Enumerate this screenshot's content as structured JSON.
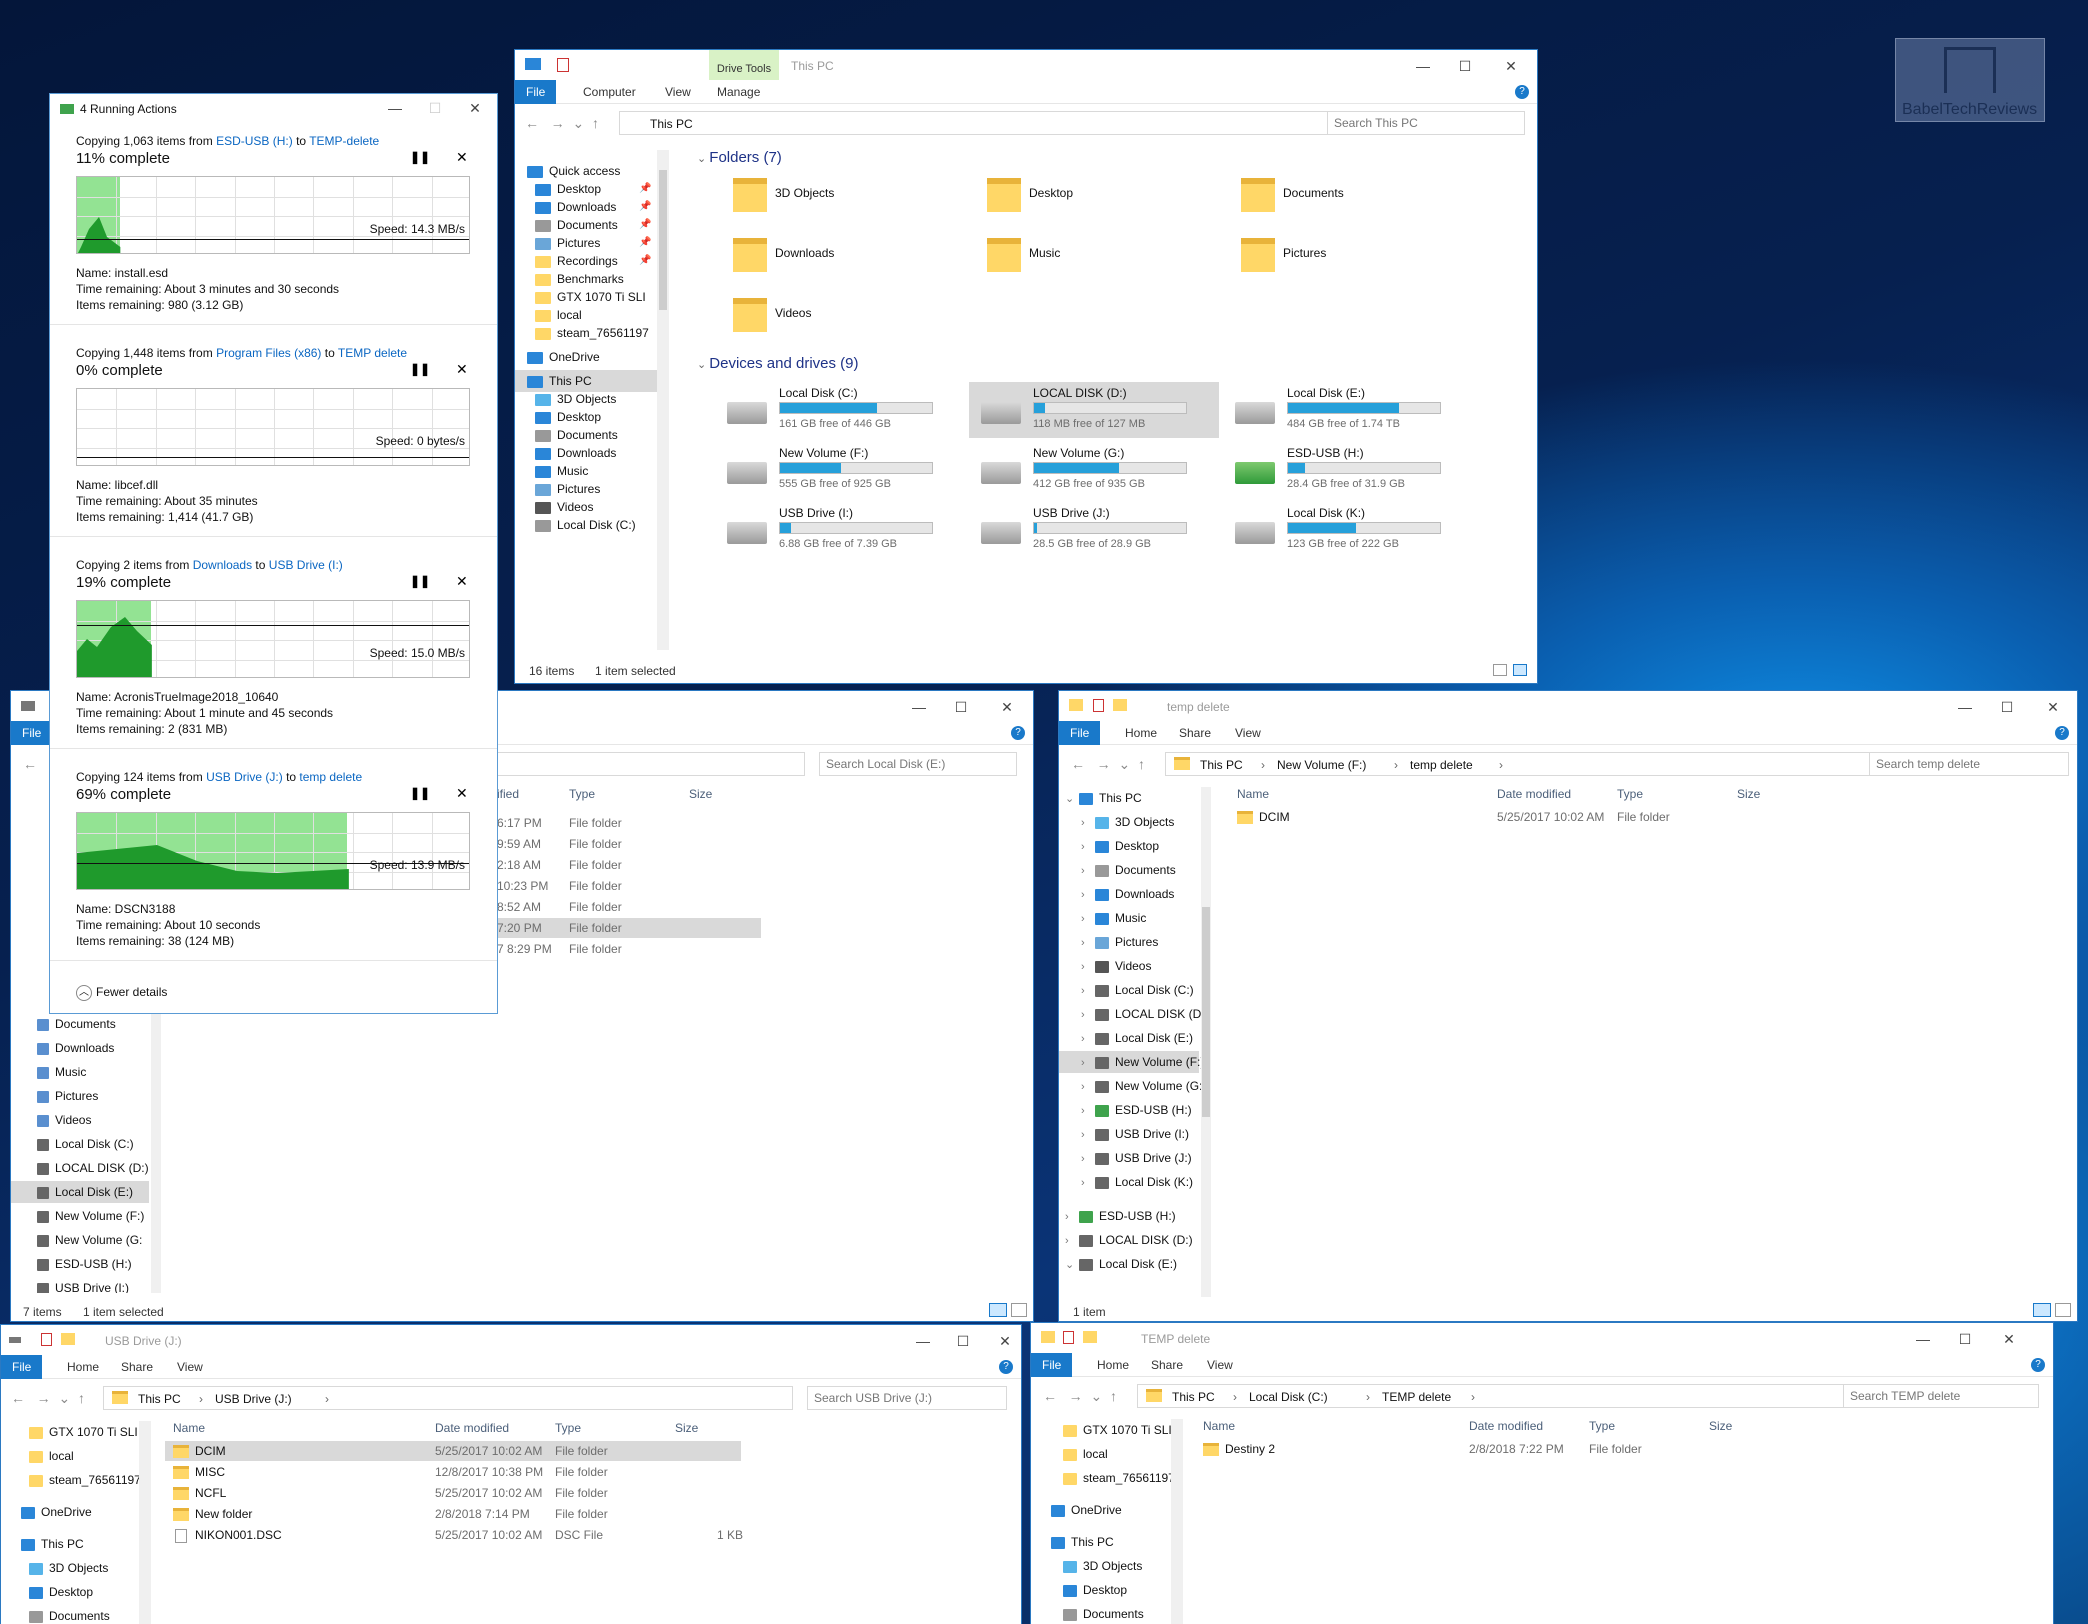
{
  "watermark": {
    "text": "BabelTechReviews"
  },
  "main": {
    "ribbon_extra": "Drive Tools",
    "title": "This PC",
    "tabs": [
      "File",
      "Computer",
      "View",
      "Manage"
    ],
    "address": "This PC",
    "search_placeholder": "Search This PC",
    "nav": [
      "Quick access",
      "Desktop",
      "Downloads",
      "Documents",
      "Pictures",
      "Recordings",
      "Benchmarks",
      "GTX 1070 Ti SLI",
      "local",
      "steam_76561197",
      "OneDrive",
      "This PC",
      "3D Objects",
      "Desktop",
      "Documents",
      "Downloads",
      "Music",
      "Pictures",
      "Videos",
      "Local Disk (C:)"
    ],
    "folders_header": "Folders (7)",
    "folders": [
      "3D Objects",
      "Desktop",
      "Documents",
      "Downloads",
      "Music",
      "Pictures",
      "Videos"
    ],
    "drives_header": "Devices and drives (9)",
    "drives": [
      {
        "name": "Local Disk (C:)",
        "free": "161 GB free of 446 GB",
        "used": 0.64
      },
      {
        "name": "LOCAL DISK (D:)",
        "free": "118 MB free of 127 MB",
        "used": 0.07
      },
      {
        "name": "Local Disk (E:)",
        "free": "484 GB free of 1.74 TB",
        "used": 0.73
      },
      {
        "name": "New Volume (F:)",
        "free": "555 GB free of 925 GB",
        "used": 0.4
      },
      {
        "name": "New Volume (G:)",
        "free": "412 GB free of 935 GB",
        "used": 0.56
      },
      {
        "name": "ESD-USB (H:)",
        "free": "28.4 GB free of 31.9 GB",
        "used": 0.11
      },
      {
        "name": "USB Drive (I:)",
        "free": "6.88 GB free of 7.39 GB",
        "used": 0.07
      },
      {
        "name": "USB Drive (J:)",
        "free": "28.5 GB free of 28.9 GB",
        "used": 0.02
      },
      {
        "name": "Local Disk (K:)",
        "free": "123 GB free of 222 GB",
        "used": 0.45
      }
    ],
    "status_items": "16 items",
    "status_selected": "1 item selected"
  },
  "copy": {
    "title": "4 Running Actions",
    "jobs": [
      {
        "line_a": "Copying 1,063 items from ",
        "src": "ESD-USB (H:)",
        "line_b": " to ",
        "dst": "TEMP-delete",
        "pct": "11% complete",
        "progress": 0.11,
        "speed": "Speed: 14.3 MB/s",
        "name": "Name:  install.esd",
        "time": "Time remaining:  About 3 minutes and 30 seconds",
        "items": "Items remaining:  980 (3.12 GB)"
      },
      {
        "line_a": "Copying 1,448 items from ",
        "src": "Program Files (x86)",
        "line_b": " to ",
        "dst": "TEMP delete",
        "pct": "0% complete",
        "progress": 0.0,
        "speed": "Speed: 0 bytes/s",
        "name": "Name:  libcef.dll",
        "time": "Time remaining:  About 35 minutes",
        "items": "Items remaining:  1,414 (41.7 GB)"
      },
      {
        "line_a": "Copying 2 items from ",
        "src": "Downloads",
        "line_b": " to ",
        "dst": "USB Drive (I:)",
        "pct": "19% complete",
        "progress": 0.19,
        "speed": "Speed: 15.0 MB/s",
        "name": "Name:  AcronisTrueImage2018_10640",
        "time": "Time remaining:  About 1 minute and 45 seconds",
        "items": "Items remaining:  2 (831 MB)"
      },
      {
        "line_a": "Copying 124 items from ",
        "src": "USB Drive (J:)",
        "line_b": " to ",
        "dst": "temp delete",
        "pct": "69% complete",
        "progress": 0.69,
        "speed": "Speed: 13.9 MB/s",
        "name": "Name:  DSCN3188",
        "time": "Time remaining:  About 10 seconds",
        "items": "Items remaining:  38 (124 MB)"
      }
    ],
    "fewer": "Fewer details"
  },
  "winE": {
    "search_placeholder": "Search Local Disk (E:)",
    "cols": [
      "Type",
      "Size"
    ],
    "rows": [
      [
        "6:17 PM",
        "File folder"
      ],
      [
        "9:59 AM",
        "File folder"
      ],
      [
        "2:18 AM",
        "File folder"
      ],
      [
        "10:23 PM",
        "File folder"
      ],
      [
        "8:52 AM",
        "File folder"
      ],
      [
        "7:20 PM",
        "File folder"
      ],
      [
        "7 8:29 PM",
        "File folder"
      ]
    ],
    "col_partial": "ified",
    "nav": [
      "Documents",
      "Downloads",
      "Music",
      "Pictures",
      "Videos",
      "Local Disk (C:)",
      "LOCAL DISK (D:)",
      "Local Disk (E:)",
      "New Volume (F:)",
      "New Volume (G:",
      "ESD-USB (H:)",
      "USB Drive (I:)"
    ],
    "file_tab": "File",
    "status_items": "7 items",
    "status_selected": "1 item selected"
  },
  "winF": {
    "title": "temp delete",
    "tabs": [
      "File",
      "Home",
      "Share",
      "View"
    ],
    "crumbs": [
      "This PC",
      "New Volume (F:)",
      "temp delete"
    ],
    "search_placeholder": "Search temp delete",
    "cols": [
      "Name",
      "Date modified",
      "Type",
      "Size"
    ],
    "rows": [
      [
        "DCIM",
        "5/25/2017 10:02 AM",
        "File folder",
        ""
      ]
    ],
    "nav": [
      "This PC",
      "3D Objects",
      "Desktop",
      "Documents",
      "Downloads",
      "Music",
      "Pictures",
      "Videos",
      "Local Disk (C:)",
      "LOCAL DISK (D:)",
      "Local Disk (E:)",
      "New Volume (F:)",
      "New Volume (G:",
      "ESD-USB (H:)",
      "USB Drive (I:)",
      "USB Drive (J:)",
      "Local Disk (K:)",
      "ESD-USB (H:)",
      "LOCAL DISK (D:)",
      "Local Disk (E:)"
    ],
    "status_items": "1 item"
  },
  "winJ": {
    "title": "USB Drive (J:)",
    "tabs": [
      "File",
      "Home",
      "Share",
      "View"
    ],
    "crumbs": [
      "This PC",
      "USB Drive (J:)"
    ],
    "search_placeholder": "Search USB Drive (J:)",
    "cols": [
      "Name",
      "Date modified",
      "Type",
      "Size"
    ],
    "rows": [
      [
        "DCIM",
        "5/25/2017 10:02 AM",
        "File folder",
        ""
      ],
      [
        "MISC",
        "12/8/2017 10:38 PM",
        "File folder",
        ""
      ],
      [
        "NCFL",
        "5/25/2017 10:02 AM",
        "File folder",
        ""
      ],
      [
        "New folder",
        "2/8/2018 7:14 PM",
        "File folder",
        ""
      ],
      [
        "NIKON001.DSC",
        "5/25/2017 10:02 AM",
        "DSC File",
        "1 KB"
      ]
    ],
    "nav": [
      "GTX 1070 Ti SLI",
      "local",
      "steam_76561197",
      "OneDrive",
      "This PC",
      "3D Objects",
      "Desktop",
      "Documents"
    ]
  },
  "winC": {
    "title": "TEMP delete",
    "tabs": [
      "File",
      "Home",
      "Share",
      "View"
    ],
    "crumbs": [
      "This PC",
      "Local Disk (C:)",
      "TEMP delete"
    ],
    "search_placeholder": "Search TEMP delete",
    "cols": [
      "Name",
      "Date modified",
      "Type",
      "Size"
    ],
    "rows": [
      [
        "Destiny 2",
        "2/8/2018 7:22 PM",
        "File folder",
        ""
      ]
    ],
    "nav": [
      "GTX 1070 Ti SLI",
      "local",
      "steam_76561197",
      "OneDrive",
      "This PC",
      "3D Objects",
      "Desktop",
      "Documents"
    ]
  }
}
